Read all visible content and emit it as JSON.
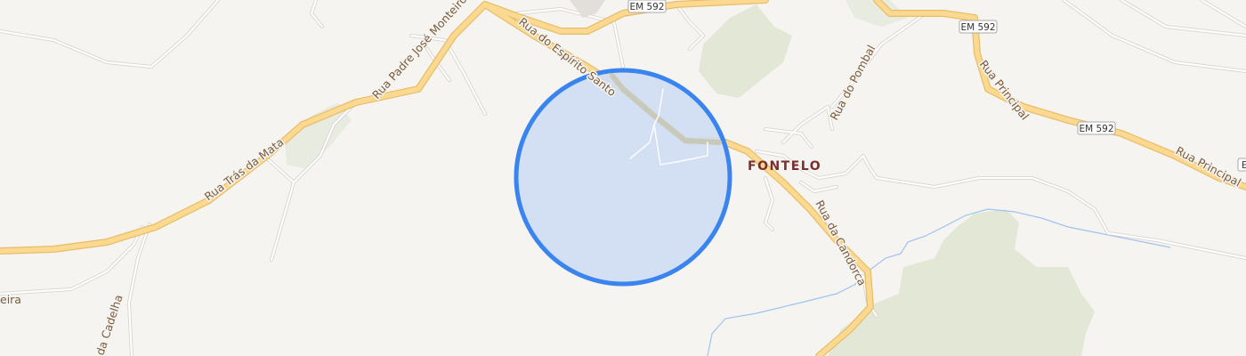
{
  "map": {
    "place_name": "FONTELO",
    "streets": {
      "padre_jose_monteiro": "Rua Padre José Monteiro",
      "tras_da_mata": "Rua Trás da Mata",
      "espirito_santo": "Rua do Espírito Santo",
      "do_pombal": "Rua do Pombal",
      "da_candorca": "Rua da Candorca",
      "principal_1": "Rua Principal",
      "principal_2": "Rua Principal",
      "da_cadelha": "da Cadelha",
      "eira_fragment": "eira"
    },
    "shields": {
      "top": "EM 592",
      "right_top": "EM 592",
      "right_mid": "EM 592",
      "edge": "E"
    },
    "colors": {
      "background": "#f6f4f1",
      "major_road": "#fbd991",
      "major_road_casing": "#e8bd6a",
      "minor_road": "#ffffff",
      "minor_road_casing": "#d8d4cf",
      "woodland": "#e3e8d6",
      "water": "#9ec3ee",
      "location_fill": "#cfddf3",
      "location_stroke": "#3a84f0"
    }
  }
}
